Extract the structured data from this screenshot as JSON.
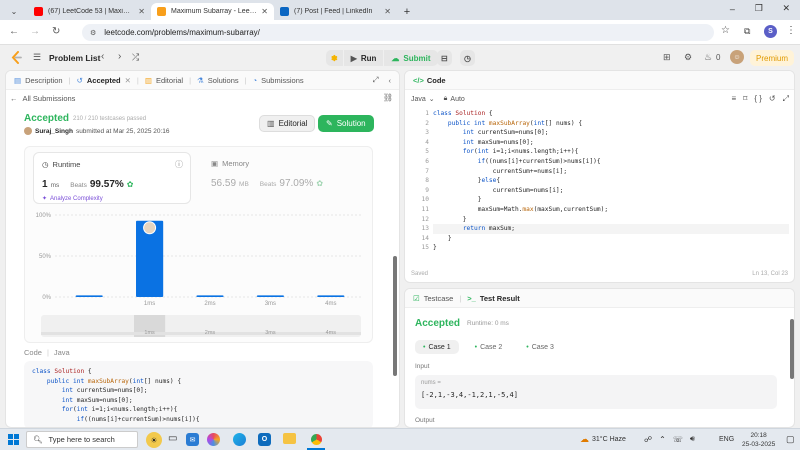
{
  "browser": {
    "tabs": [
      {
        "title": "(67) LeetCode 53 | Maximum Su...",
        "icon": "youtube-icon",
        "color": "#ff0000"
      },
      {
        "title": "Maximum Subarray - LeetCode",
        "icon": "leetcode-icon",
        "color": "#f89f1b",
        "active": true
      },
      {
        "title": "(7) Post | Feed | LinkedIn",
        "icon": "linkedin-icon",
        "color": "#0a66c2"
      }
    ],
    "new_tab": "+",
    "url": "leetcode.com/problems/maximum-subarray/",
    "profile_letter": "S"
  },
  "lc_header": {
    "problem_list": "Problem List",
    "run": "Run",
    "submit": "Submit",
    "coins": "0",
    "premium": "Premium"
  },
  "left_tabs": {
    "description": "Description",
    "accepted": "Accepted",
    "editorial": "Editorial",
    "solutions": "Solutions",
    "submissions": "Submissions"
  },
  "all_submissions": "All Submissions",
  "result": {
    "status": "Accepted",
    "passed": "210 / 210 testcases passed",
    "user": "Suraj_Singh",
    "submitted_text": "submitted at Mar 25, 2025 20:16",
    "editorial_btn": "Editorial",
    "solution_btn": "Solution"
  },
  "runtime": {
    "label": "Runtime",
    "value": "1",
    "unit": "ms",
    "beats_label": "Beats",
    "beats": "99.57%",
    "analyze": "Analyze Complexity"
  },
  "memory": {
    "label": "Memory",
    "value": "56.59",
    "unit": "MB",
    "beats_label": "Beats",
    "beats": "97.09%"
  },
  "chart_data": {
    "type": "bar",
    "y_ticks": [
      "100%",
      "50%",
      "0%"
    ],
    "categories": [
      "1ms",
      "2ms",
      "3ms",
      "4ms"
    ],
    "ylim": [
      0,
      100
    ],
    "bars": [
      {
        "x": "0ms",
        "value": 2
      },
      {
        "x": "1ms",
        "value": 93
      },
      {
        "x": "2ms",
        "value": 2
      },
      {
        "x": "3ms",
        "value": 2
      },
      {
        "x": "4ms",
        "value": 2
      }
    ],
    "bar_color": "#0a72e3",
    "range_labels": [
      "1ms",
      "2ms",
      "3ms",
      "4ms"
    ]
  },
  "code_section": {
    "label": "Code",
    "lang": "Java"
  },
  "left_code": [
    "class Solution {",
    "    public int maxSubArray(int[] nums) {",
    "        int currentSum=nums[0];",
    "        int maxSum=nums[0];",
    "        for(int i=1;i<nums.length;i++){",
    "            if((nums[i]+currentSum)>nums[i]){"
  ],
  "editor": {
    "title": "Code",
    "lang": "Java",
    "auto": "Auto",
    "saved": "Saved",
    "cursor": "Ln 13, Col 23",
    "lines": [
      "class Solution {",
      "    public int maxSubArray(int[] nums) {",
      "        int currentSum=nums[0];",
      "        int maxSum=nums[0];",
      "        for(int i=1;i<nums.length;i++){",
      "            if((nums[i]+currentSum)>nums[i]){",
      "                currentSum+=nums[i];",
      "            }else{",
      "                currentSum=nums[i];",
      "            }",
      "            maxSum=Math.max(maxSum,currentSum);",
      "        }",
      "        return maxSum;",
      "    }",
      "}"
    ]
  },
  "testpanel": {
    "testcase_tab": "Testcase",
    "result_tab": "Test Result",
    "status": "Accepted",
    "runtime": "Runtime: 0 ms",
    "cases": [
      "Case 1",
      "Case 2",
      "Case 3"
    ],
    "input_label": "Input",
    "var_name": "nums =",
    "var_value": "[-2,1,-3,4,-1,2,1,-5,4]",
    "output_label": "Output"
  },
  "taskbar": {
    "search": "Type here to search",
    "weather": "31°C  Haze",
    "lang": "ENG",
    "time": "20:18",
    "date": "25-03-2025"
  }
}
